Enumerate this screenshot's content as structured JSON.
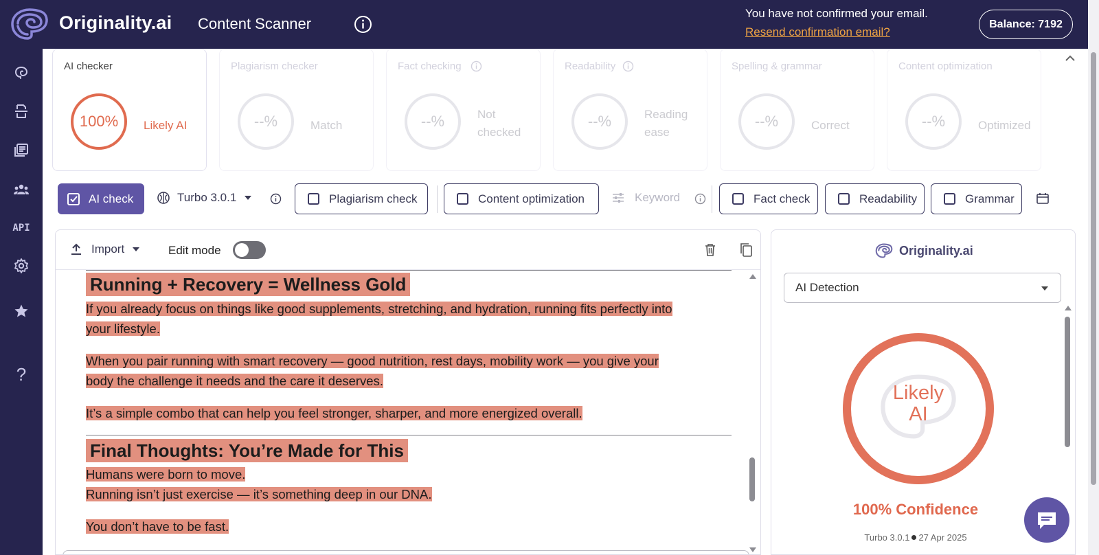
{
  "header": {
    "brand": "Originality.ai",
    "title": "Content Scanner",
    "email_notice": "You have not confirmed your email.",
    "resend_link": "Resend confirmation email?",
    "balance": "Balance: 7192"
  },
  "sidebar": {
    "items": [
      {
        "icon": "brain-icon"
      },
      {
        "icon": "scan-document-icon"
      },
      {
        "icon": "library-icon"
      },
      {
        "icon": "team-icon"
      },
      {
        "icon": "api-icon",
        "label": "API"
      },
      {
        "icon": "gear-icon"
      },
      {
        "icon": "star-icon"
      },
      {
        "icon": "help-icon",
        "label": "?"
      }
    ]
  },
  "cards": [
    {
      "title": "AI checker",
      "value": "100%",
      "status": "Likely AI",
      "active": true
    },
    {
      "title": "Plagiarism checker",
      "value": "--%",
      "status": "Match",
      "active": false
    },
    {
      "title": "Fact checking",
      "value": "--%",
      "status_lines": [
        "Not",
        "checked"
      ],
      "active": false
    },
    {
      "title": "Readability",
      "value": "--%",
      "status_lines": [
        "Reading",
        "ease"
      ],
      "active": false
    },
    {
      "title": "Spelling & grammar",
      "value": "--%",
      "status": "Correct",
      "active": false
    },
    {
      "title": "Content optimization",
      "value": "--%",
      "status": "Optimized",
      "active": false
    }
  ],
  "toolbar": {
    "ai_check": "AI check",
    "model": "Turbo 3.0.1",
    "plagiarism": "Plagiarism check",
    "content_opt": "Content optimization",
    "keyword": "Keyword",
    "fact_check": "Fact check",
    "readability": "Readability",
    "grammar": "Grammar"
  },
  "editor": {
    "import": "Import",
    "edit_mode": "Edit mode",
    "edit_mode_on": false,
    "heading1": "Running + Recovery = Wellness Gold",
    "p1_line1": "If you already focus on things like good supplements, stretching, and hydration, running fits perfectly into",
    "p1_line2": "your lifestyle.",
    "p2_line1": "When you pair running with smart recovery — good nutrition, rest days, mobility work — you give your",
    "p2_line2": "body the challenge it needs and the care it deserves.",
    "p3": "It’s a simple combo that can help you feel stronger, sharper, and more energized overall.",
    "heading2": "Final Thoughts: You’re Made for This",
    "p4_line1": "Humans were born to move.",
    "p4_line2": "Running isn’t just exercise — it’s something deep in our DNA.",
    "p5": "You don’t have to be fast."
  },
  "panel": {
    "brand": "Originality.ai",
    "select": "AI Detection",
    "verdict_line1": "Likely",
    "verdict_line2": "AI",
    "confidence": "100% Confidence",
    "model": "Turbo 3.0.1",
    "date": "27 Apr 2025"
  },
  "colors": {
    "nav": "#26244e",
    "accent": "#5f55a5",
    "ai_red": "#e2725a",
    "highlight": "#e2907f",
    "link": "#f0a443"
  }
}
